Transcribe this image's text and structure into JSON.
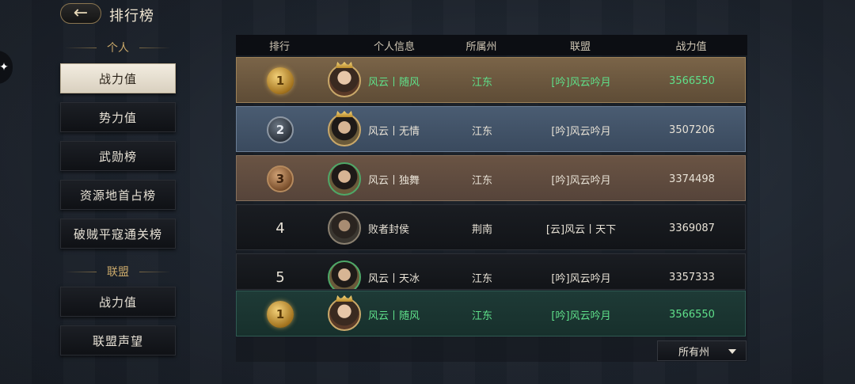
{
  "header": {
    "title": "排行榜",
    "back_label": "←"
  },
  "sidebar": {
    "personal_section": "个人",
    "personal_items": [
      {
        "label": "战力值",
        "active": true
      },
      {
        "label": "势力值",
        "active": false
      },
      {
        "label": "武勋榜",
        "active": false
      },
      {
        "label": "资源地首占榜",
        "active": false
      },
      {
        "label": "破贼平寇通关榜",
        "active": false
      }
    ],
    "alliance_section": "联盟",
    "alliance_items": [
      {
        "label": "战力值"
      },
      {
        "label": "联盟声望"
      }
    ]
  },
  "table": {
    "headers": {
      "rank": "排行",
      "info": "个人信息",
      "state": "所属州",
      "alliance": "联盟",
      "power": "战力值"
    },
    "rows": [
      {
        "rank": "1",
        "name": "风云丨随风",
        "state": "江东",
        "alliance": "[吟]风云吟月",
        "power": "3566550"
      },
      {
        "rank": "2",
        "name": "风云丨无情",
        "state": "江东",
        "alliance": "[吟]风云吟月",
        "power": "3507206"
      },
      {
        "rank": "3",
        "name": "风云丨独舞",
        "state": "江东",
        "alliance": "[吟]风云吟月",
        "power": "3374498"
      },
      {
        "rank": "4",
        "name": "败者封侯",
        "state": "荆南",
        "alliance": "[云]风云丨天下",
        "power": "3369087"
      },
      {
        "rank": "5",
        "name": "风云丨天冰",
        "state": "江东",
        "alliance": "[吟]风云吟月",
        "power": "3357333"
      }
    ],
    "self_row": {
      "rank": "1",
      "name": "风云丨随风",
      "state": "江东",
      "alliance": "[吟]风云吟月",
      "power": "3566550"
    }
  },
  "filter": {
    "selected": "所有州"
  },
  "colors": {
    "highlight_text": "#5fe08a",
    "gold": "#c9a86a"
  }
}
